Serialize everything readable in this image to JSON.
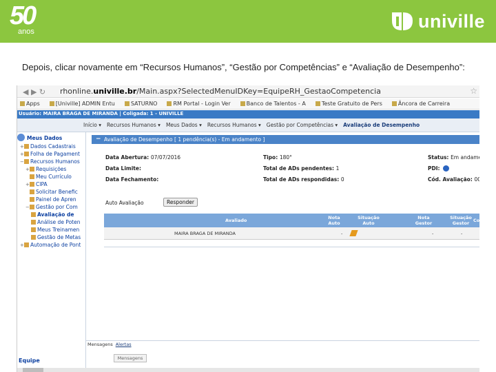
{
  "header": {
    "logo_number": "50",
    "logo_sub": "anos",
    "brand": "univille"
  },
  "caption": "Depois, clicar novamente em “Recursos Humanos”, “Gestão por Competências” e “Avaliação de Desempenho”:",
  "browser": {
    "url_prefix": "rhonline.",
    "url_domain": "univille.br",
    "url_suffix": "/Main.aspx?SelectedMenuIDKey=EquipeRH_GestaoCompetencia",
    "bookmarks": [
      "Apps",
      "[Univille] ADMIN Entu",
      "SATURNO",
      "RM Portal - Login Ver",
      "Banco de Talentos - A",
      "Teste Gratuito de Pers",
      "Âncora de Carreira"
    ]
  },
  "userbar": "Usuário: MAIRA BRAGA DE MIRANDA | Coligada: 1 - UNIVILLE",
  "breadcrumbs": [
    "Início ▾",
    "Recursos Humanos ▾",
    "Meus Dados ▾",
    "Recursos Humanos ▾",
    "Gestão por Competências ▾",
    "Avaliação de Desempenho"
  ],
  "tree": {
    "root": "Meus Dados",
    "items": [
      "Dados Cadastrais",
      "Folha de Pagament",
      "Recursos Humanos",
      "Requisições",
      "Meu Currículo",
      "CIPA",
      "Solicitar Benefic",
      "Painel de Apren",
      "Gestão por Com",
      "Avaliação de",
      "Análise de Poten",
      "Meus Treinamen",
      "Gestão de Metas",
      "Automação de Pont"
    ],
    "footer": "Equipe"
  },
  "panel": {
    "title": "Avaliação de Desempenho [ 1 pendência(s) - Em andamento ]",
    "fields": {
      "data_abertura_label": "Data Abertura:",
      "data_abertura": "07/07/2016",
      "data_limite_label": "Data Limite:",
      "data_limite": "",
      "data_fechamento_label": "Data Fechamento:",
      "data_fechamento": "",
      "tipo_label": "Tipo:",
      "tipo": "180°",
      "pendentes_label": "Total de ADs pendentes:",
      "pendentes": "1",
      "respondidas_label": "Total de ADs respondidas:",
      "respondidas": "0",
      "status_label": "Status:",
      "status": "Em andame",
      "pdi_label": "PDI:",
      "cod_label": "Cód. Avaliação:",
      "cod": "00"
    },
    "auto_label": "Auto Avaliação",
    "respond_button": "Responder"
  },
  "grid": {
    "headers": [
      "Avaliado",
      "Nota Auto",
      "Situação Auto",
      "Nota Gestor",
      "Situação Gestor",
      "Co"
    ],
    "row": {
      "avaliado": "MAIRA BRAGA DE MIRANDA",
      "nota_auto": "-",
      "nota_gestor": "-",
      "situacao_gestor": "-"
    }
  },
  "bottom": {
    "tabs": [
      "Mensagens",
      "Alertas"
    ],
    "button": "Mensagens"
  }
}
